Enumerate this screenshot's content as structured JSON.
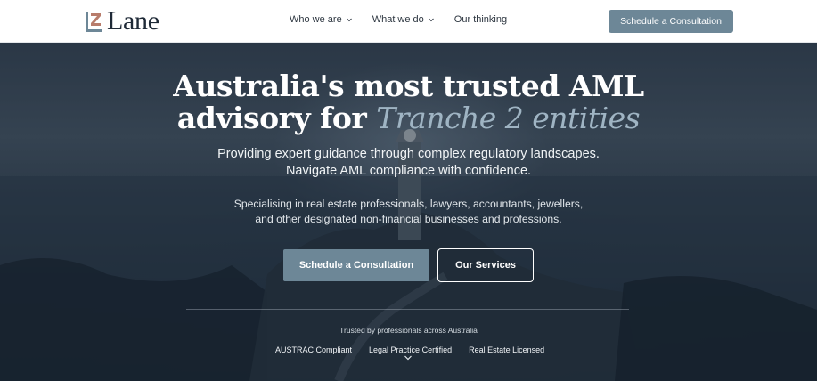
{
  "brand": {
    "name": "Lane",
    "colors": {
      "accent": "#6d8797",
      "dark": "#1f2a37",
      "logo_mark": "#b87c6b"
    }
  },
  "nav": {
    "items": [
      {
        "label": "Who we are",
        "has_dropdown": true
      },
      {
        "label": "What we do",
        "has_dropdown": true
      },
      {
        "label": "Our thinking",
        "has_dropdown": false
      }
    ],
    "cta_label": "Schedule a Consultation"
  },
  "hero": {
    "headline_line1": "Australia's most trusted AML",
    "headline_line2_prefix": "advisory for ",
    "headline_line2_accent": "Tranche 2 entities",
    "subtitle_line1": "Providing expert guidance through complex regulatory landscapes.",
    "subtitle_line2": "Navigate AML compliance with confidence.",
    "specialising_line1": "Specialising in real estate professionals, lawyers, accountants, jewellers,",
    "specialising_line2": "and other designated non-financial businesses and professions.",
    "primary_button": "Schedule a Consultation",
    "secondary_button": "Our Services",
    "trusted_text": "Trusted by professionals across Australia",
    "badges": [
      "AUSTRAC Compliant",
      "Legal Practice Certified",
      "Real Estate Licensed"
    ]
  },
  "icons": [
    "logo-mark-icon",
    "chevron-down-icon",
    "scroll-down-chevron-icon"
  ]
}
